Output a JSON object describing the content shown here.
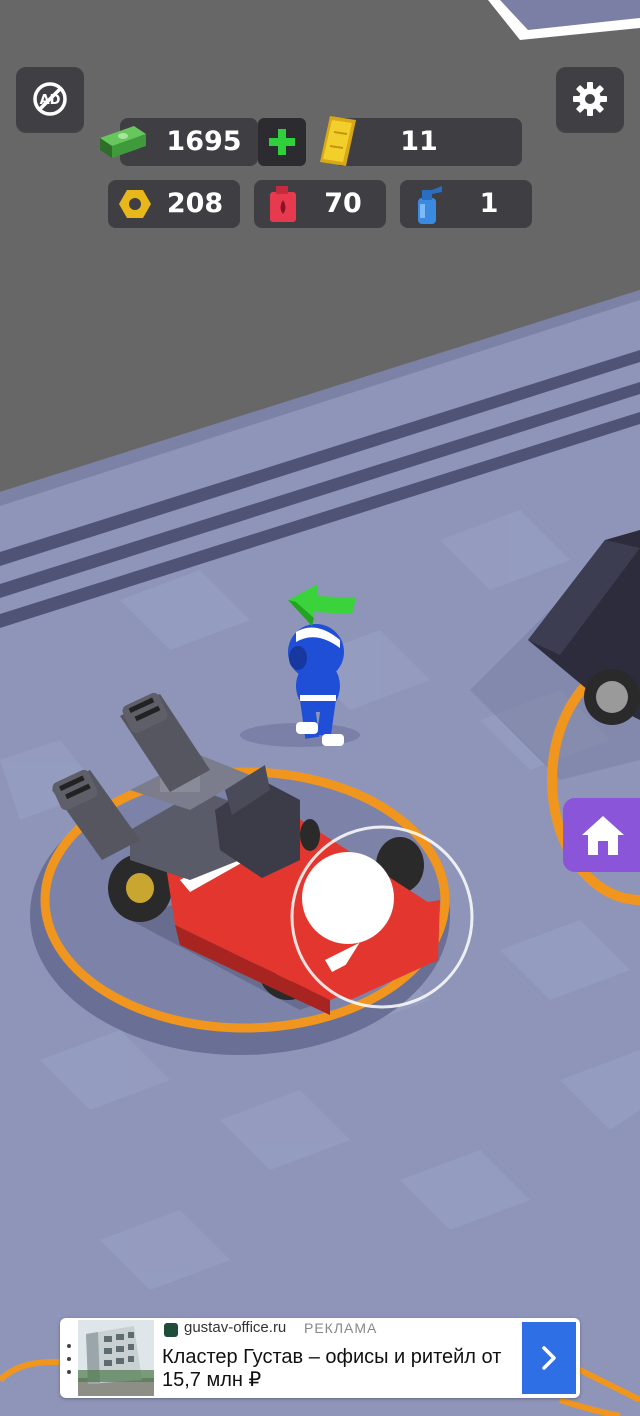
{
  "hud": {
    "remove_ads_icon": "no-ads-icon",
    "settings_icon": "gear-icon",
    "cash": {
      "icon": "cash-stack-icon",
      "value": "1695",
      "add_icon": "plus-icon"
    },
    "tickets": {
      "icon": "golden-ticket-icon",
      "value": "11"
    },
    "nuts": {
      "icon": "hex-nut-icon",
      "value": "208"
    },
    "fuel": {
      "icon": "red-fuel-can-icon",
      "value": "70"
    },
    "bottles": {
      "icon": "blue-spray-bottle-icon",
      "value": "1"
    }
  },
  "side": {
    "home_icon": "home-icon",
    "color": "#8a55d8"
  },
  "joystick": {
    "knob": "joystick-knob",
    "ring": "joystick-ring"
  },
  "ad": {
    "domain": "gustav-office.ru",
    "tag": "РЕКЛАМА",
    "title": "Кластер Густав – офисы и ритейл от 15,7 млн ₽",
    "arrow_icon": "chevron-right-icon",
    "menu_icon": "more-vertical-icon"
  },
  "colors": {
    "wall": "#676767",
    "floor": "#8e95b9",
    "hud_panel": "#3e3e43",
    "ring": "#f0961e",
    "kart": "#e2362e",
    "player": "#1f4fd6",
    "arrow": "#3bd33b",
    "ad_button": "#2f6fe6"
  }
}
